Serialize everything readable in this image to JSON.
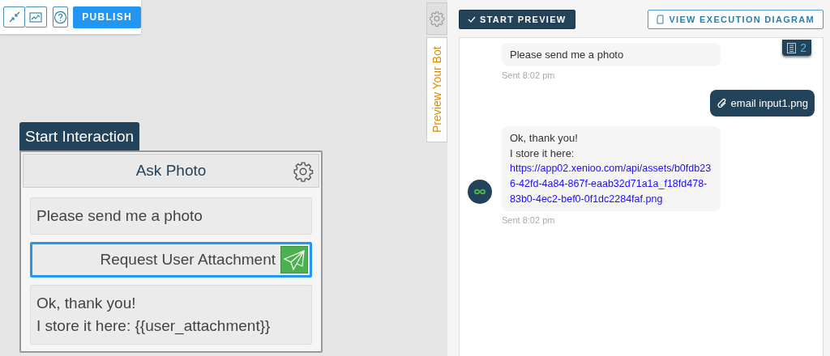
{
  "toolbar": {
    "publish_label": "PUBLISH"
  },
  "canvas": {
    "start_label": "Start Interaction",
    "node": {
      "title": "Ask Photo",
      "actions": [
        {
          "kind": "text",
          "lines": [
            "Please send me a photo"
          ],
          "selected": false
        },
        {
          "kind": "request_attachment",
          "lines": [
            "Request User Attachment"
          ],
          "selected": true
        },
        {
          "kind": "text",
          "lines": [
            "Ok, thank you!",
            "I store it here: {{user_attachment}}"
          ],
          "selected": false
        }
      ]
    }
  },
  "side_tabs": [
    {
      "kind": "settings",
      "selected": false
    },
    {
      "kind": "label",
      "label": "Preview Your Bot",
      "selected": true
    }
  ],
  "preview": {
    "start_button": "START PREVIEW",
    "diagram_button": "VIEW EXECUTION DIAGRAM",
    "log_count": "2",
    "messages": [
      {
        "kind": "bot_text",
        "lines": [
          "Please send me a photo"
        ],
        "time": "Sent 8:02 pm",
        "avatar": false
      },
      {
        "kind": "user_attachment",
        "lines": [
          "email input1.png"
        ]
      },
      {
        "kind": "bot_text",
        "lines": [
          "Ok, thank you!",
          "I store it here:"
        ],
        "link": "https://app02.xenioo.com/api/assets/b0fdb236-42fd-4a84-867f-eaab32d71a1a_f18fd478-83b0-4ec2-bef0-0f1dc2284faf.png",
        "time": "Sent 8:02 pm",
        "avatar": true
      }
    ]
  }
}
